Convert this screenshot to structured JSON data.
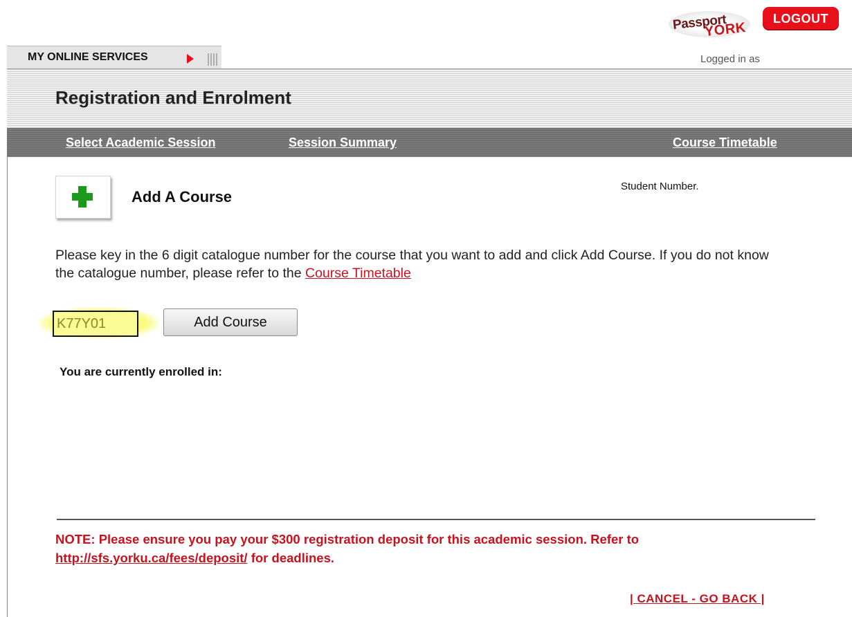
{
  "branding": {
    "logo_word_1": "Passport",
    "logo_word_2": "YORK",
    "logout_label": "LOGOUT"
  },
  "tab": {
    "label": "MY ONLINE SERVICES"
  },
  "logged_in": "Logged in as",
  "header": {
    "title": "Registration and Enrolment"
  },
  "nav": {
    "select_session": "Select Academic Session",
    "session_summary": "Session Summary",
    "course_timetable": "Course Timetable"
  },
  "add_course": {
    "heading": "Add A Course",
    "student_number_label": "Student Number.",
    "instructions_before_link": "Please key in the 6 digit catalogue number for the course that you want to add and click Add Course. If you do not know the catalogue number, please refer to the ",
    "instructions_link": "Course Timetable",
    "input_value": "K77Y01",
    "button_label": "Add Course"
  },
  "enrolled": {
    "heading": "You are currently enrolled in:"
  },
  "note": {
    "text_before_link": "NOTE: Please ensure you pay your $300 registration deposit for this academic session. Refer to ",
    "link": "http://sfs.yorku.ca/fees/deposit/",
    "text_after_link": " for deadlines."
  },
  "cancel_label": "| CANCEL - GO BACK |"
}
